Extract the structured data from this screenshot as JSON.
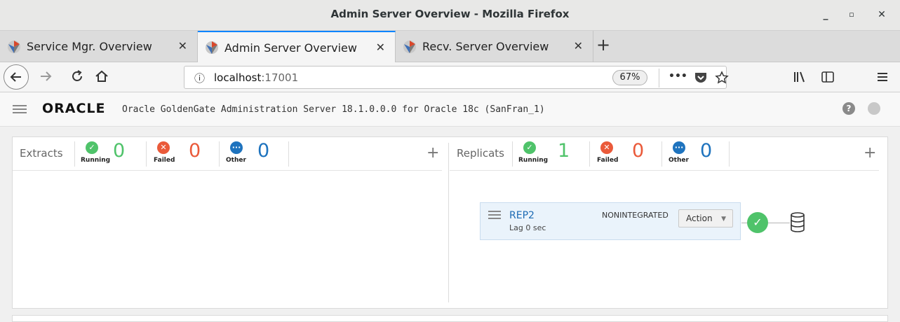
{
  "window": {
    "title": "Admin Server Overview - Mozilla Firefox",
    "minimize": "_",
    "maximize": "▫",
    "close": "✕"
  },
  "tabs": [
    {
      "label": "Service Mgr. Overview",
      "close": "✕"
    },
    {
      "label": "Admin Server Overview",
      "close": "✕"
    },
    {
      "label": "Recv. Server Overview",
      "close": "✕"
    }
  ],
  "new_tab": "+",
  "nav": {
    "url_host": "localhost",
    "url_port": ":17001",
    "zoom": "67%",
    "info_icon": "ⓘ",
    "more_icon": "•••"
  },
  "app": {
    "brand": "ORACLE",
    "title": "Oracle GoldenGate Administration Server 18.1.0.0.0 for Oracle 18c (SanFran_1)",
    "help": "?"
  },
  "extracts": {
    "title": "Extracts",
    "running": {
      "label": "Running",
      "count": "0"
    },
    "failed": {
      "label": "Failed",
      "count": "0"
    },
    "other": {
      "label": "Other",
      "count": "0"
    },
    "add": "+"
  },
  "replicats": {
    "title": "Replicats",
    "running": {
      "label": "Running",
      "count": "1"
    },
    "failed": {
      "label": "Failed",
      "count": "0"
    },
    "other": {
      "label": "Other",
      "count": "0"
    },
    "add": "+",
    "items": [
      {
        "name": "REP2",
        "lag": "Lag 0 sec",
        "mode": "NONINTEGRATED",
        "action": "Action",
        "status": "running"
      }
    ]
  },
  "colors": {
    "running": "#4fc36a",
    "failed": "#ea5a3a",
    "other": "#1e73be",
    "accent": "#0a84ff"
  }
}
